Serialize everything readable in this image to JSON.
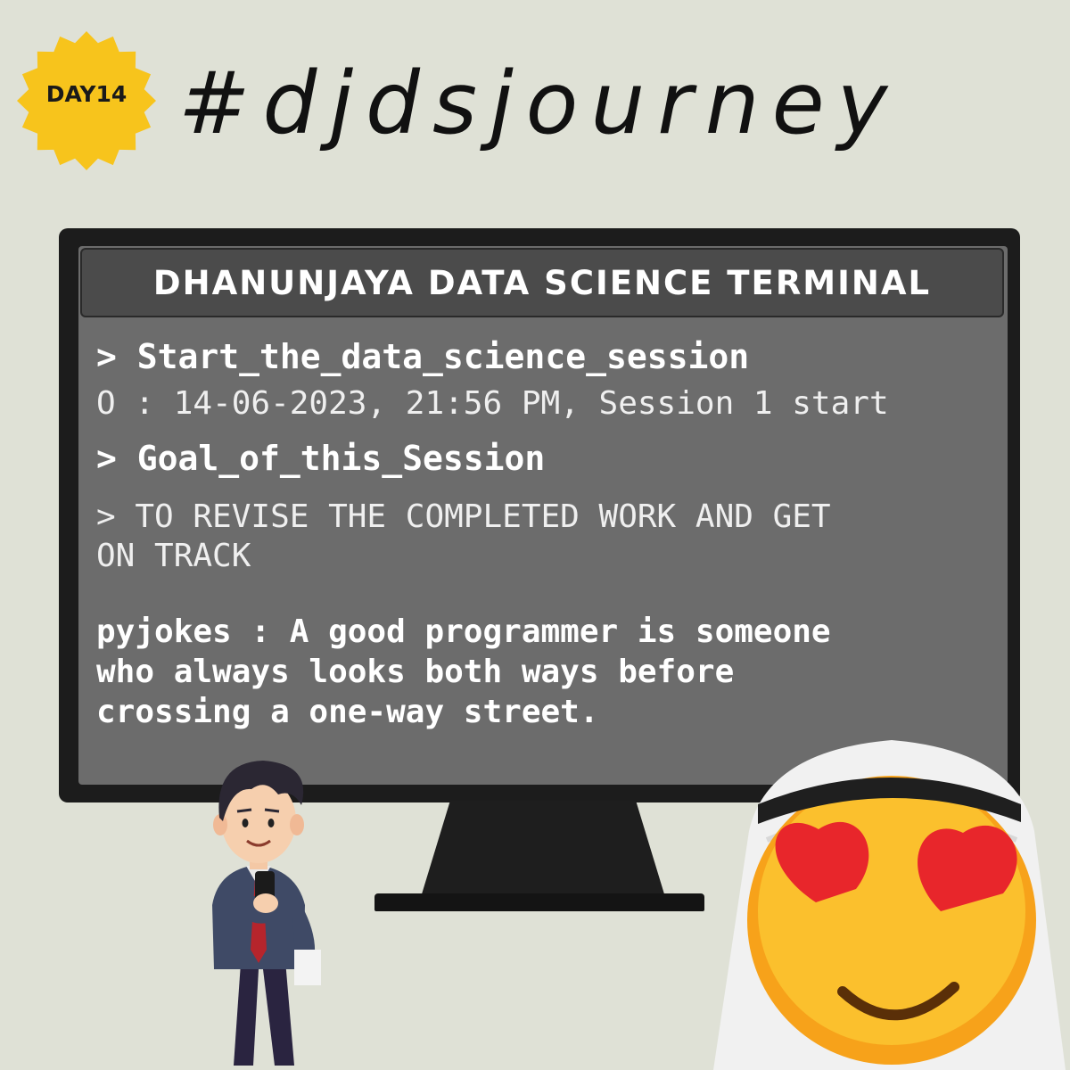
{
  "badge": {
    "label": "DAY14",
    "color": "#f7c41c"
  },
  "hashtag": "#djdsjourney",
  "terminal": {
    "title": "DHANUNJAYA DATA SCIENCE TERMINAL",
    "command1": "> Start_the_data_science_session",
    "output1": "O : 14-06-2023, 21:56 PM, Session 1 start",
    "command2": "> Goal_of_this_Session",
    "goal_line1": "> TO REVISE THE COMPLETED WORK AND GET",
    "goal_line2": "ON TRACK",
    "joke_line1": "pyjokes : A good programmer is someone",
    "joke_line2": "who always looks both ways before",
    "joke_line3": "crossing a one-way street."
  },
  "illustrations": {
    "man": "man-with-phone-illustration",
    "emoji": "heart-eyes-emoji-with-keffiyeh"
  },
  "colors": {
    "background": "#dfe1d6",
    "screen": "#6c6c6c",
    "title_bar": "#4b4b4b",
    "frame": "#1c1c1c"
  }
}
